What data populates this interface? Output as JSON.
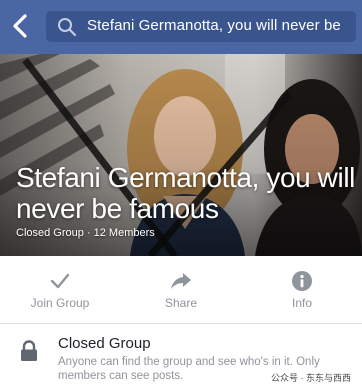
{
  "search": {
    "query": "Stefani Germanotta, you will never be"
  },
  "group": {
    "title": "Stefani Germanotta, you will never be famous",
    "subtitle": "Closed Group · 12 Members"
  },
  "actions": [
    {
      "label": "Join Group",
      "icon": "checkmark-icon"
    },
    {
      "label": "Share",
      "icon": "share-arrow-icon"
    },
    {
      "label": "Info",
      "icon": "info-icon"
    }
  ],
  "privacy": {
    "title": "Closed Group",
    "description": "Anyone can find the group and see who's in it. Only members can see posts.",
    "icon": "lock-icon"
  },
  "watermark": "公众号 · 东东与西西",
  "colors": {
    "topbar": "#4b67a3",
    "search_field": "#3a548d",
    "muted_text": "#90949c"
  }
}
